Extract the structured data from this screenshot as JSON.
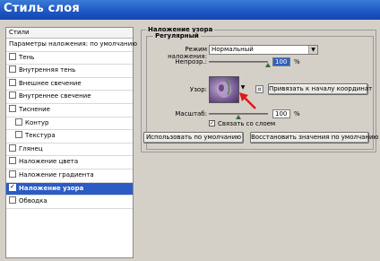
{
  "window": {
    "title": "Стиль слоя"
  },
  "sidebar": {
    "header": "Стили",
    "items": [
      {
        "label": "Параметры наложения: по умолчанию",
        "checkbox": false,
        "checked": false,
        "sub": false,
        "selected": false
      },
      {
        "label": "Тень",
        "checkbox": true,
        "checked": false,
        "sub": false,
        "selected": false
      },
      {
        "label": "Внутренняя тень",
        "checkbox": true,
        "checked": false,
        "sub": false,
        "selected": false
      },
      {
        "label": "Внешнее свечение",
        "checkbox": true,
        "checked": false,
        "sub": false,
        "selected": false
      },
      {
        "label": "Внутреннее свечение",
        "checkbox": true,
        "checked": false,
        "sub": false,
        "selected": false
      },
      {
        "label": "Тиснение",
        "checkbox": true,
        "checked": false,
        "sub": false,
        "selected": false
      },
      {
        "label": "Контур",
        "checkbox": true,
        "checked": false,
        "sub": true,
        "selected": false
      },
      {
        "label": "Текстура",
        "checkbox": true,
        "checked": false,
        "sub": true,
        "selected": false
      },
      {
        "label": "Глянец",
        "checkbox": true,
        "checked": false,
        "sub": false,
        "selected": false
      },
      {
        "label": "Наложение цвета",
        "checkbox": true,
        "checked": false,
        "sub": false,
        "selected": false
      },
      {
        "label": "Наложение градиента",
        "checkbox": true,
        "checked": false,
        "sub": false,
        "selected": false
      },
      {
        "label": "Наложение узора",
        "checkbox": true,
        "checked": true,
        "sub": false,
        "selected": true
      },
      {
        "label": "Обводка",
        "checkbox": true,
        "checked": false,
        "sub": false,
        "selected": false
      }
    ]
  },
  "panel": {
    "group_title": "Наложение узора",
    "subgroup_title": "Регулярный",
    "blend_mode": {
      "label": "Режим наложения:",
      "value": "Нормальный"
    },
    "opacity": {
      "label": "Непрозр.:",
      "value": "100",
      "unit": "%",
      "level": 1.0
    },
    "pattern": {
      "label": "Узор:",
      "snap_button": "Привязать к началу координат"
    },
    "scale": {
      "label": "Масштаб:",
      "value": "100",
      "unit": "%",
      "level": 0.5
    },
    "link_layer": {
      "label": "Связать со слоем",
      "checked": true
    },
    "buttons": {
      "default": "Использовать по умолчанию",
      "reset": "Восстановить значения по умолчанию"
    }
  },
  "colors": {
    "titlebar": "#1d56c4",
    "selected": "#2a5cc4",
    "face": "#d4d0c8",
    "arrow": "#e01818"
  }
}
